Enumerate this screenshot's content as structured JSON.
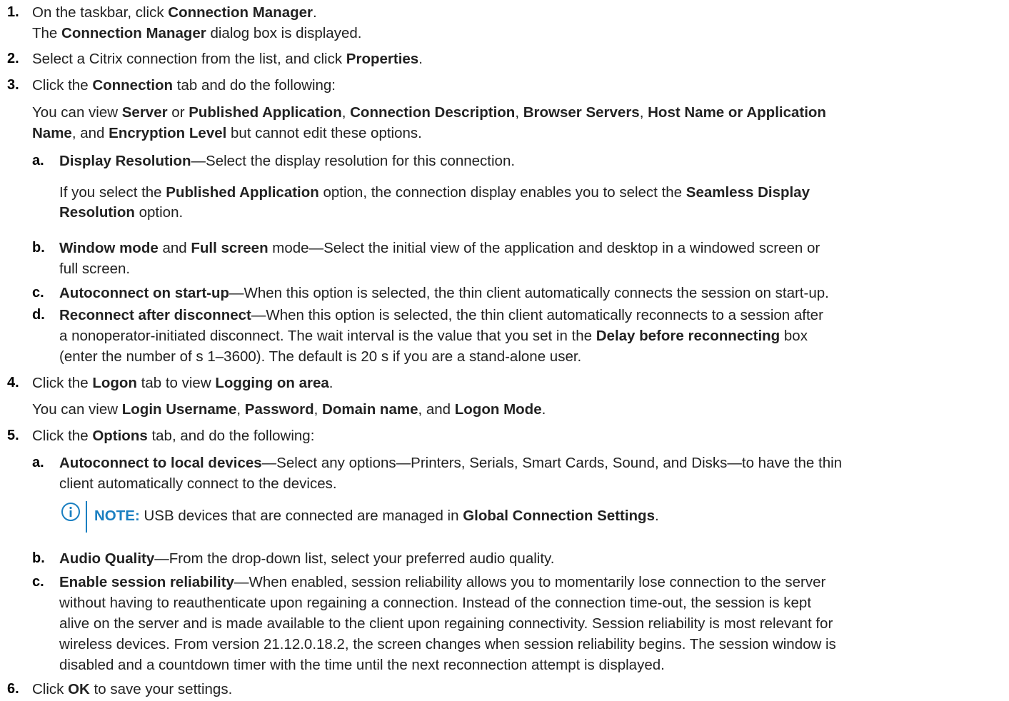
{
  "steps": [
    {
      "num": "1.",
      "line1": [
        "On the taskbar, click ",
        "Connection Manager",
        "."
      ],
      "line2": [
        "The ",
        "Connection Manager",
        " dialog box is displayed."
      ]
    },
    {
      "num": "2.",
      "line1": [
        "Select a Citrix connection from the list, and click ",
        "Properties",
        "."
      ]
    },
    {
      "num": "3.",
      "line1": [
        "Click the ",
        "Connection",
        " tab and do the following:"
      ],
      "para_l1": [
        "You can view ",
        "Server",
        " or ",
        "Published Application",
        ", ",
        "Connection Description",
        ", ",
        "Browser Servers",
        ", ",
        "Host Name or Application"
      ],
      "para_l2": [
        "Name",
        ", and ",
        "Encryption Level",
        " but cannot edit these options."
      ]
    },
    {
      "num": "4.",
      "line1": [
        "Click the ",
        "Logon",
        " tab to view ",
        "Logging on area",
        "."
      ],
      "para_l1": [
        "You can view ",
        "Login Username",
        ", ",
        "Password",
        ", ",
        "Domain name",
        ", and ",
        "Logon Mode",
        "."
      ]
    },
    {
      "num": "5.",
      "line1": [
        "Click the ",
        "Options",
        " tab, and do the following:"
      ]
    },
    {
      "num": "6.",
      "line1": [
        "Click ",
        "OK",
        " to save your settings."
      ]
    }
  ],
  "sub3": [
    {
      "letter": "a.",
      "l1": [
        "Display Resolution",
        "—Select the display resolution for this connection."
      ],
      "p1": [
        "If you select the ",
        "Published Application",
        " option, the connection display enables you to select the ",
        "Seamless Display"
      ],
      "p2": [
        "Resolution",
        " option."
      ]
    },
    {
      "letter": "b.",
      "l1": [
        "Window mode",
        " and ",
        "Full screen",
        " mode—Select the initial view of the application and desktop in a windowed screen or"
      ],
      "l2": "full screen."
    },
    {
      "letter": "c.",
      "l1": [
        "Autoconnect on start-up",
        "—When this option is selected, the thin client automatically connects the session on start-up."
      ]
    },
    {
      "letter": "d.",
      "l1": [
        "Reconnect after disconnect",
        "—When this option is selected, the thin client automatically reconnects to a session after"
      ],
      "l2": [
        "a nonoperator-initiated disconnect. The wait interval is the value that you set in the ",
        "Delay before reconnecting",
        " box"
      ],
      "l3": "(enter the number of s 1–3600). The default is 20 s if you are a stand-alone user."
    }
  ],
  "sub5": [
    {
      "letter": "a.",
      "l1": [
        "Autoconnect to local devices",
        "—Select any options—Printers, Serials, Smart Cards, Sound, and Disks—to have the thin"
      ],
      "l2": "client automatically connect to the devices."
    },
    {
      "letter": "b.",
      "l1": [
        "Audio Quality",
        "—From the drop-down list, select your preferred audio quality."
      ]
    },
    {
      "letter": "c.",
      "l1": [
        "Enable session reliability",
        "—When enabled, session reliability allows you to momentarily lose connection to the server"
      ],
      "l2": "without having to reauthenticate upon regaining a connection. Instead of the connection time-out, the session is kept",
      "l3": "alive on the server and is made available to the client upon regaining connectivity. Session reliability is most relevant for",
      "l4": "wireless devices. From version 21.12.0.18.2, the screen changes when session reliability begins. The session window is",
      "l5": "disabled and a countdown timer with the time until the next reconnection attempt is displayed."
    }
  ],
  "note": {
    "label": "NOTE:",
    "text": [
      " USB devices that are connected are managed in ",
      "Global Connection Settings",
      "."
    ]
  },
  "colors": {
    "text": "#222222",
    "note_accent": "#1a7fc1"
  },
  "icons": {
    "note": "info-icon"
  }
}
